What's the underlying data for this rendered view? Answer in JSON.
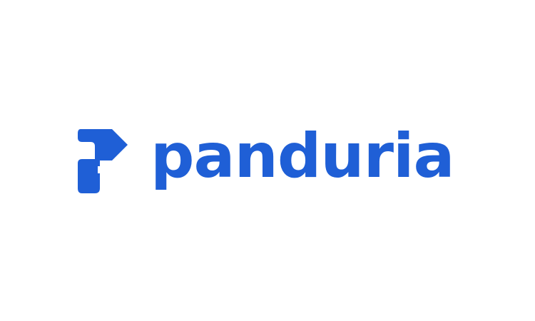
{
  "brand": {
    "name": "panduria",
    "color": "#1f5fd6",
    "logo_mark": "panduria-p-arrow-icon"
  },
  "background": "#ffffff"
}
